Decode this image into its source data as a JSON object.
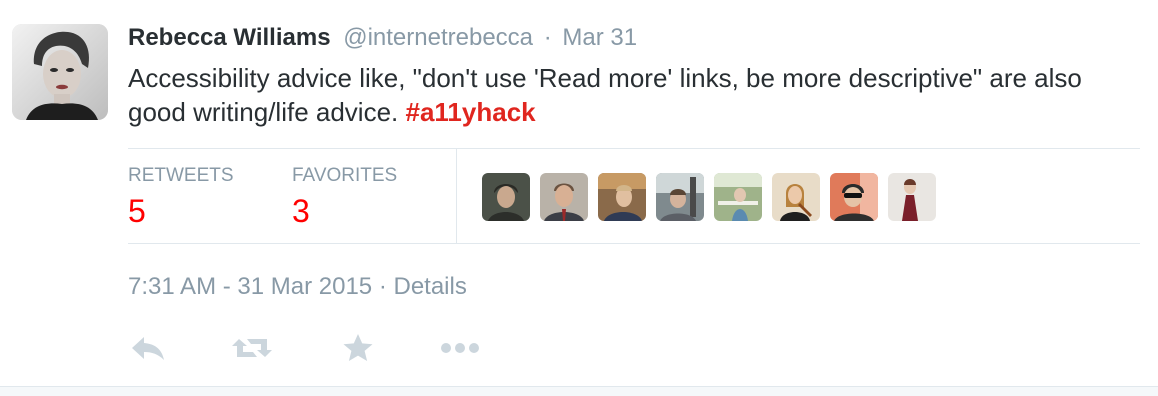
{
  "tweet": {
    "fullname": "Rebecca Williams",
    "username": "@internetrebecca",
    "separator": "·",
    "date": "Mar 31",
    "text_before": "Accessibility advice like, \"don't use 'Read more' links, be more descriptive\" are also good writing/life advice. ",
    "hashtag": "#a11yhack",
    "stats": {
      "retweets_label": "RETWEETS",
      "retweets_count": "5",
      "favorites_label": "FAVORITES",
      "favorites_count": "3"
    },
    "timestamp": "7:31 AM - 31 Mar 2015",
    "timestamp_separator": "·",
    "details_label": "Details"
  },
  "actions": {
    "reply": "reply-icon",
    "retweet": "retweet-icon",
    "favorite": "star-icon",
    "more": "more-dots-icon"
  },
  "colors": {
    "text": "#292f33",
    "muted": "#8899a6",
    "hashtag": "#e0261f",
    "count": "#ff0000",
    "border": "#e1e8ed",
    "icon": "#ccd6dd"
  }
}
